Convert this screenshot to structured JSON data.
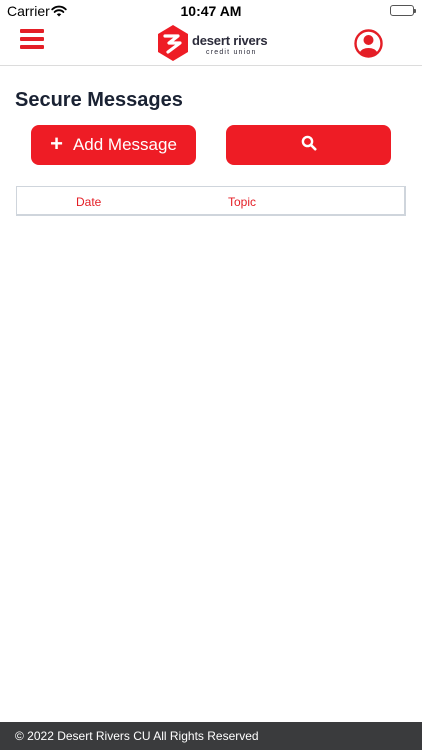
{
  "status_bar": {
    "carrier": "Carrier",
    "time": "10:47 AM",
    "icons": [
      "wifi-icon",
      "battery-icon"
    ]
  },
  "header": {
    "menu_icon": "hamburger-menu-icon",
    "logo": {
      "name": "desert rivers",
      "sub": "credit union"
    },
    "profile_icon": "user-account-icon"
  },
  "page": {
    "title": "Secure Messages"
  },
  "actions": {
    "add_label": "Add Message",
    "add_icon": "plus-icon",
    "search_icon": "search-icon"
  },
  "table": {
    "columns": [
      "Date",
      "Topic"
    ]
  },
  "footer": {
    "copyright": "© 2022 Desert Rivers CU All Rights Reserved"
  },
  "colors": {
    "accent": "#ee1c25",
    "title": "#1a2233",
    "footer_bg": "#3a3b3d"
  }
}
